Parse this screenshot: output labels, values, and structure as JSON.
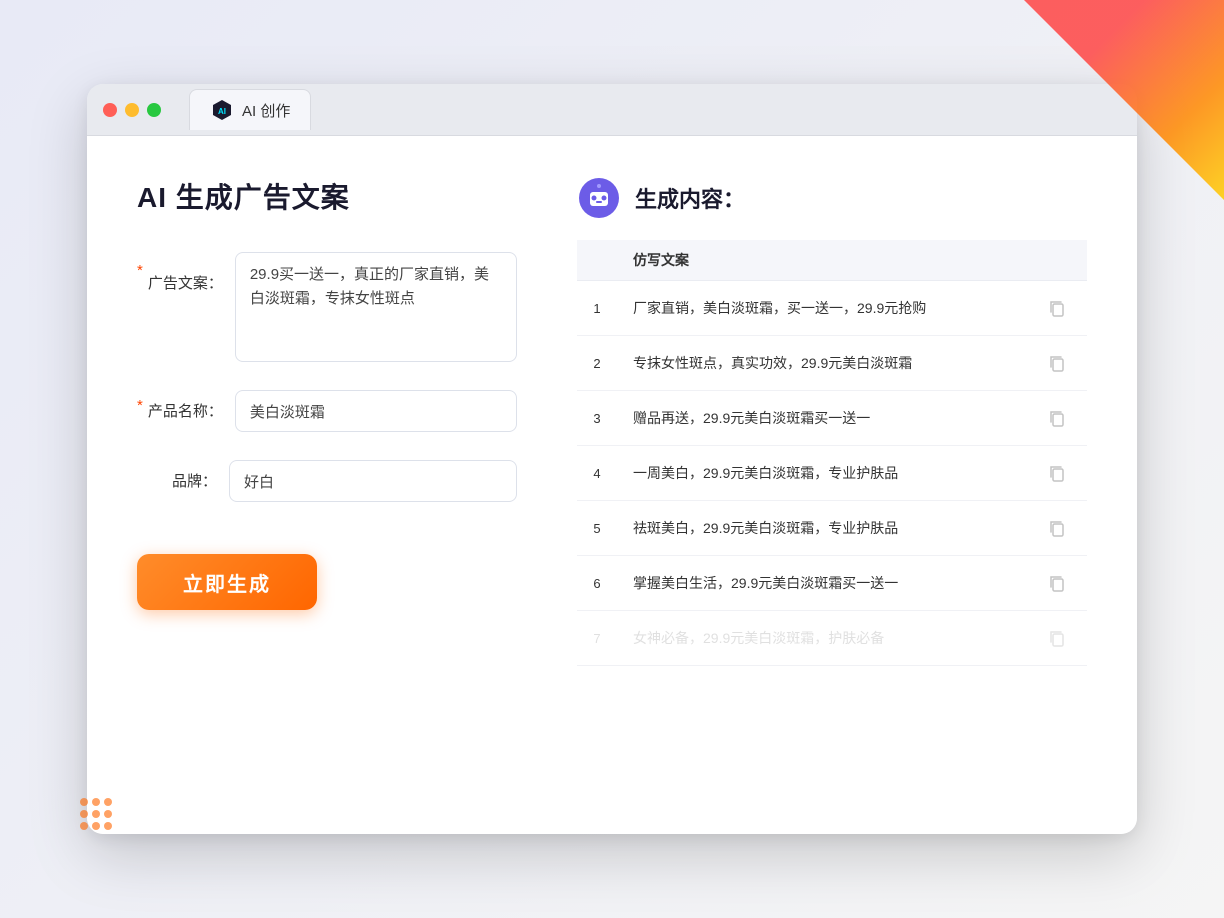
{
  "browser": {
    "tab_label": "AI 创作"
  },
  "left_panel": {
    "page_title": "AI 生成广告文案",
    "form": {
      "ad_copy_label": "广告文案：",
      "ad_copy_required": "*",
      "ad_copy_value": "29.9买一送一，真正的厂家直销，美白淡斑霜，专抹女性斑点",
      "product_name_label": "产品名称：",
      "product_name_required": "*",
      "product_name_value": "美白淡斑霜",
      "brand_label": "品牌：",
      "brand_value": "好白"
    },
    "generate_btn_label": "立即生成"
  },
  "right_panel": {
    "result_title": "生成内容：",
    "table_header": "仿写文案",
    "results": [
      {
        "id": 1,
        "text": "厂家直销，美白淡斑霜，买一送一，29.9元抢购"
      },
      {
        "id": 2,
        "text": "专抹女性斑点，真实功效，29.9元美白淡斑霜"
      },
      {
        "id": 3,
        "text": "赠品再送，29.9元美白淡斑霜买一送一"
      },
      {
        "id": 4,
        "text": "一周美白，29.9元美白淡斑霜，专业护肤品"
      },
      {
        "id": 5,
        "text": "祛斑美白，29.9元美白淡斑霜，专业护肤品"
      },
      {
        "id": 6,
        "text": "掌握美白生活，29.9元美白淡斑霜买一送一"
      },
      {
        "id": 7,
        "text": "女神必备，29.9元美白淡斑霜，护肤必备",
        "dimmed": true
      }
    ]
  }
}
